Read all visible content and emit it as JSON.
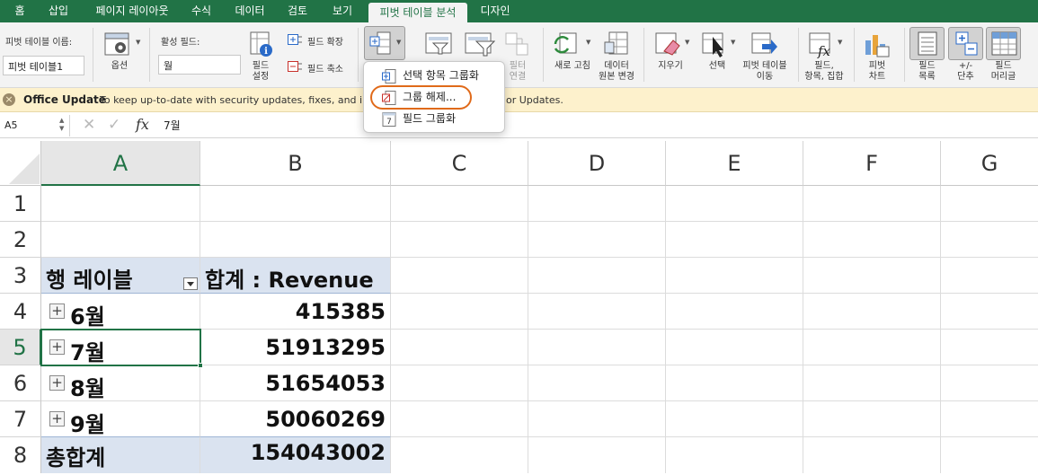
{
  "menu": {
    "tabs": [
      "홈",
      "삽입",
      "페이지 레이아웃",
      "수식",
      "데이터",
      "검토",
      "보기",
      "피벗 테이블 분석",
      "디자인"
    ],
    "active_tab": "피벗 테이블 분석"
  },
  "ribbon": {
    "pivot_name_label": "피벗 테이블 이름:",
    "pivot_name_value": "피벗 테이블1",
    "options_label": "옵션",
    "active_field_label": "활성 필드:",
    "active_field_value": "월",
    "field_settings_label": "필드\n설정",
    "expand_field_label": "필드 확장",
    "collapse_field_label": "필드 축소",
    "filter_connections_label": "필터\n연결",
    "refresh_label": "새로 고침",
    "change_source_label": "데이터\n원본 변경",
    "clear_label": "지우기",
    "select_label": "선택",
    "move_pivot_label": "피벗 테이블\n이동",
    "fields_items_sets_label": "필드,\n항목, 집합",
    "pivot_chart_label": "피벗\n차트",
    "field_list_label": "필드\n목록",
    "buttons_label": "+/-\n단추",
    "field_headers_label": "필드\n머리글"
  },
  "group_menu": {
    "items": [
      "선택 항목 그룹화",
      "그룹 해제...",
      "필드 그룹화"
    ],
    "highlighted": "그룹 해제..."
  },
  "message_bar": {
    "title": "Office Update",
    "text_before": "To keep up-to-date with security updates, fixes, and im",
    "text_after": "or Updates."
  },
  "formula_bar": {
    "name_box": "A5",
    "formula": "7월"
  },
  "sheet": {
    "columns": [
      "A",
      "B",
      "C",
      "D",
      "E",
      "F",
      "G"
    ],
    "rows": [
      "1",
      "2",
      "3",
      "4",
      "5",
      "6",
      "7",
      "8"
    ],
    "selected_cell": "A5",
    "pivot": {
      "row_label_header": "행 레이블",
      "value_header": "합계 : Revenue",
      "rows": [
        {
          "label": "6월",
          "value": "415385"
        },
        {
          "label": "7월",
          "value": "51913295"
        },
        {
          "label": "8월",
          "value": "51654053"
        },
        {
          "label": "9월",
          "value": "50060269"
        }
      ],
      "total_label": "총합계",
      "total_value": "154043002"
    }
  },
  "colors": {
    "accent": "#217346",
    "pivot_header_fill": "#dae3f0",
    "message_bar": "#fdf1cc",
    "highlight_ring": "#e06a1a"
  }
}
